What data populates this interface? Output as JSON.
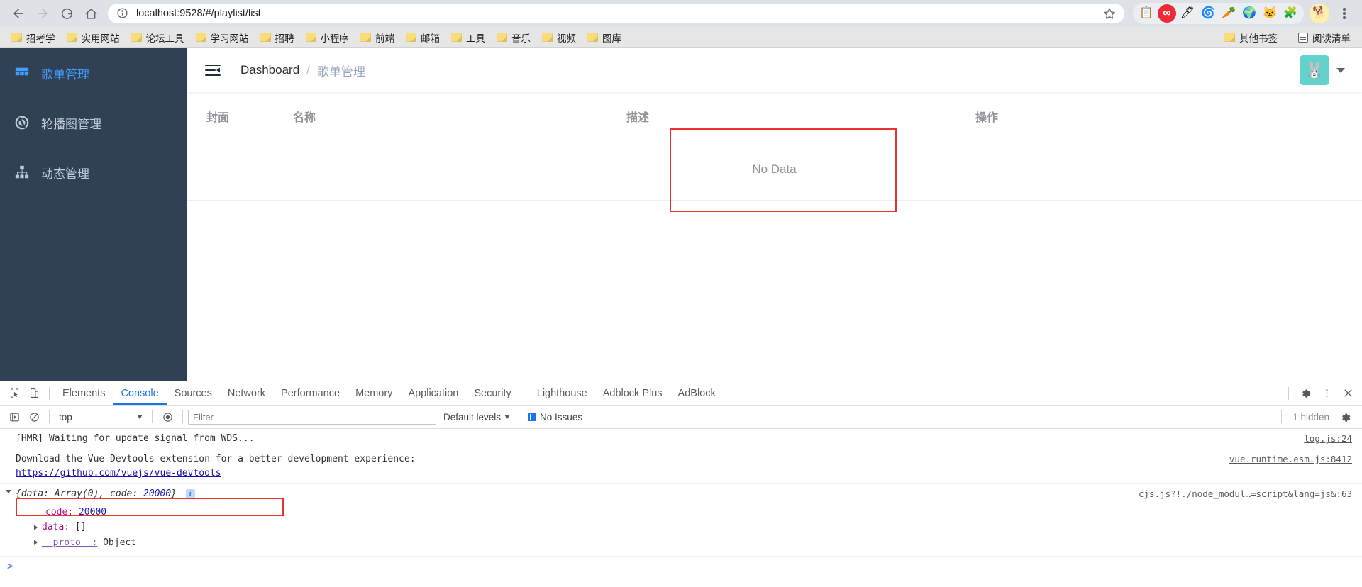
{
  "browser": {
    "back_label": "back-navigation",
    "forward_label": "forward-navigation",
    "reload_label": "reload",
    "home_label": "home",
    "url": "localhost:9528/#/playlist/list",
    "bookmarks": [
      {
        "label": "招考学"
      },
      {
        "label": "实用网站"
      },
      {
        "label": "论坛工具"
      },
      {
        "label": "学习网站"
      },
      {
        "label": "招聘"
      },
      {
        "label": "小程序"
      },
      {
        "label": "前端"
      },
      {
        "label": "邮箱"
      },
      {
        "label": "工具"
      },
      {
        "label": "音乐"
      },
      {
        "label": "视频"
      },
      {
        "label": "图库"
      }
    ],
    "bookmarks_right": [
      {
        "label": "其他书签",
        "icon": "folder-icon"
      },
      {
        "label": "阅读清单",
        "icon": "reading-list-icon"
      }
    ],
    "extensions": [
      {
        "name": "clipboard-extension-icon",
        "glyph": "📋"
      },
      {
        "name": "infinity-extension-icon",
        "glyph": "∞"
      },
      {
        "name": "pencil-circle-extension-icon",
        "glyph": "🖊"
      },
      {
        "name": "maze-extension-icon",
        "glyph": "🌀"
      },
      {
        "name": "carrot-extension-icon",
        "glyph": "🥕"
      },
      {
        "name": "idm-extension-icon",
        "glyph": "🌍"
      },
      {
        "name": "cat-extension-icon",
        "glyph": "🐱"
      },
      {
        "name": "puzzle-extensions-icon",
        "glyph": "🧩"
      },
      {
        "name": "profile-avatar-icon",
        "glyph": "🐕"
      }
    ]
  },
  "app": {
    "sidebar": {
      "items": [
        {
          "label": "歌单管理",
          "icon": "grid-icon",
          "active": true
        },
        {
          "label": "轮播图管理",
          "icon": "carousel-icon",
          "active": false
        },
        {
          "label": "动态管理",
          "icon": "sitemap-icon",
          "active": false
        }
      ]
    },
    "navbar": {
      "hamburger": "hamburger-collapse-icon",
      "breadcrumb": {
        "root": "Dashboard",
        "separator": "/",
        "current": "歌单管理"
      },
      "avatar_glyph": "🐰",
      "avatar_color": "#62d2cc"
    },
    "table": {
      "columns": [
        "封面",
        "名称",
        "描述",
        "操作"
      ],
      "rows": [],
      "empty_text": "No Data"
    }
  },
  "devtools": {
    "tabs": [
      {
        "label": "Elements",
        "active": false
      },
      {
        "label": "Console",
        "active": true
      },
      {
        "label": "Sources",
        "active": false
      },
      {
        "label": "Network",
        "active": false
      },
      {
        "label": "Performance",
        "active": false
      },
      {
        "label": "Memory",
        "active": false
      },
      {
        "label": "Application",
        "active": false
      },
      {
        "label": "Security",
        "active": false
      },
      {
        "label": "Lighthouse",
        "active": false
      },
      {
        "label": "Adblock Plus",
        "active": false
      },
      {
        "label": "AdBlock",
        "active": false
      }
    ],
    "toolbar": {
      "inspect_icon": "inspect-element-icon",
      "device_icon": "device-toolbar-icon",
      "settings_icon": "gear-icon",
      "more_icon": "more-options-icon",
      "close_icon": "close-icon"
    },
    "filterbar": {
      "execute_icon": "execution-context-icon",
      "clear_icon": "clear-console-icon",
      "context": "top",
      "eye_icon": "live-expression-icon",
      "filter_placeholder": "Filter",
      "levels_label": "Default levels",
      "issues_label": "No Issues",
      "hidden_label": "1 hidden",
      "console_settings_icon": "gear-icon"
    },
    "messages": [
      {
        "type": "text",
        "text": "[HMR] Waiting for update signal from WDS...",
        "source": "log.js:24"
      },
      {
        "type": "link",
        "text": "Download the Vue Devtools extension for a better development experience:",
        "link": "https://github.com/vuejs/vue-devtools",
        "source": "vue.runtime.esm.js:8412"
      }
    ],
    "object_log": {
      "preview_prefix": "{data: Array(0), code: ",
      "preview_num": "20000",
      "preview_suffix": "}",
      "info_badge": "i",
      "source": "cjs.js?!./node_modul…=script&lang=js&:63",
      "props": [
        {
          "key": "code:",
          "value": "20000",
          "kind": "number",
          "expandable": false
        },
        {
          "key": "data:",
          "value": "[]",
          "kind": "plain",
          "expandable": true
        },
        {
          "key": "__proto__:",
          "value": "Object",
          "kind": "proto",
          "expandable": true
        }
      ]
    },
    "prompt": ">"
  },
  "annotations": {
    "box_color": "#e8322b",
    "boxes": [
      {
        "name": "no-data-highlight"
      },
      {
        "name": "console-object-highlight"
      }
    ]
  }
}
